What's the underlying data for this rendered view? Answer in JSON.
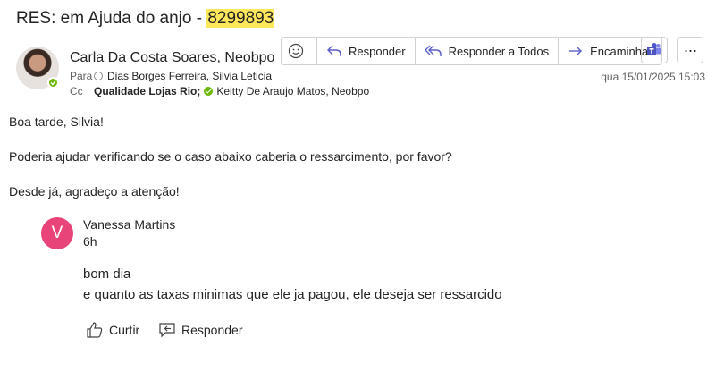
{
  "email": {
    "subject_prefix": "RES: em Ajuda do anjo - ",
    "subject_highlight": "8299893",
    "sender": "Carla Da Costa Soares, Neobpo",
    "to_label": "Para",
    "to_value": "Dias Borges Ferreira, Silvia Leticia",
    "cc_label": "Cc",
    "cc_value1": "Qualidade Lojas Rio;",
    "cc_value2": "Keitty De Araujo Matos, Neobpo",
    "date": "qua 15/01/2025 15:03"
  },
  "toolbar": {
    "reply": "Responder",
    "reply_all": "Responder a Todos",
    "forward": "Encaminhar",
    "more": "···"
  },
  "body": {
    "greeting": "Boa tarde, Silvia!",
    "request": "Poderia ajudar verificando se o caso abaixo caberia o ressarcimento, por favor?",
    "thanks": "Desde já, agradeço a atenção!"
  },
  "quote": {
    "initial": "V",
    "name": "Vanessa Martins",
    "time": "6h",
    "line1": "bom dia",
    "line2": "e quanto as taxas minimas que ele ja pagou, ele deseja ser ressarcido",
    "like": "Curtir",
    "reply": "Responder"
  },
  "colors": {
    "highlight": "#ffe75c",
    "presence": "#6bb700",
    "avatar_v": "#e8447a",
    "accent": "#5b5fc7"
  }
}
